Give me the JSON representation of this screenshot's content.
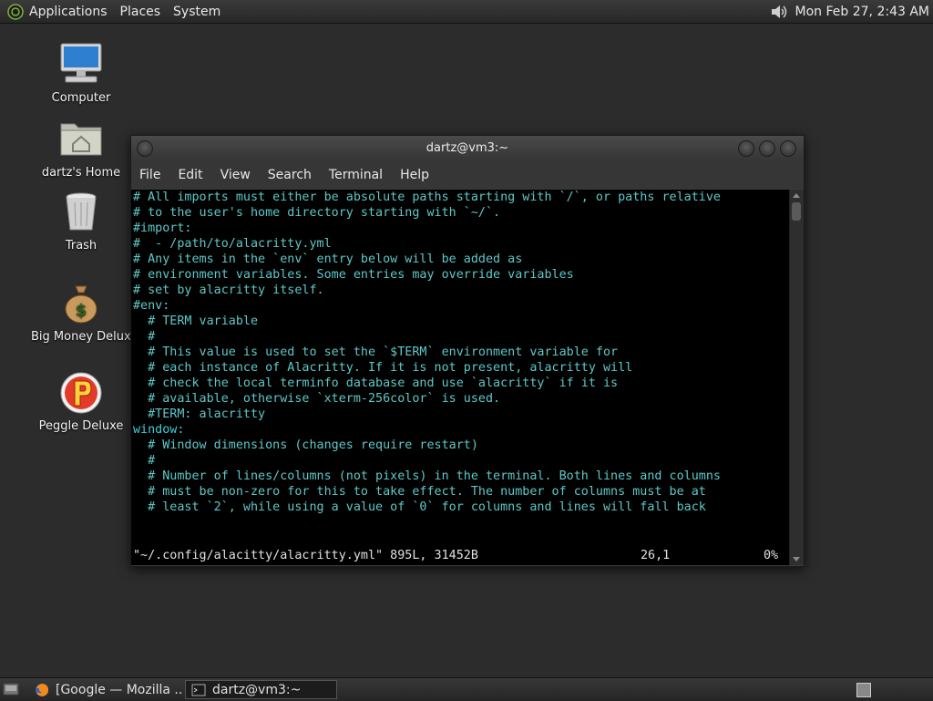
{
  "top_panel": {
    "menus": [
      "Applications",
      "Places",
      "System"
    ],
    "clock": "Mon Feb 27,  2:43 AM",
    "icons": [
      "distro-logo-icon",
      "volume-icon"
    ]
  },
  "desktop": {
    "icons": [
      {
        "label": "Computer",
        "icon": "computer-icon"
      },
      {
        "label": "dartz's Home",
        "icon": "home-folder-icon"
      },
      {
        "label": "Trash",
        "icon": "trash-icon"
      },
      {
        "label": "Big Money Deluxe",
        "icon": "money-bag-icon"
      },
      {
        "label": "Peggle Deluxe",
        "icon": "peggle-icon"
      }
    ]
  },
  "terminal": {
    "title": "dartz@vm3:~",
    "menus": [
      "File",
      "Edit",
      "View",
      "Search",
      "Terminal",
      "Help"
    ],
    "lines": [
      "# All imports must either be absolute paths starting with `/`, or paths relative",
      "# to the user's home directory starting with `~/`.",
      "#import:",
      "#  - /path/to/alacritty.yml",
      "",
      "# Any items in the `env` entry below will be added as",
      "# environment variables. Some entries may override variables",
      "# set by alacritty itself.",
      "#env:",
      "  # TERM variable",
      "  #",
      "  # This value is used to set the `$TERM` environment variable for",
      "  # each instance of Alacritty. If it is not present, alacritty will",
      "  # check the local terminfo database and use `alacritty` if it is",
      "  # available, otherwise `xterm-256color` is used.",
      "  #TERM: alacritty",
      "",
      "window:",
      "  # Window dimensions (changes require restart)",
      "  #",
      "  # Number of lines/columns (not pixels) in the terminal. Both lines and columns",
      "  # must be non-zero for this to take effect. The number of columns must be at",
      "  # least `2`, while using a value of `0` for columns and lines will fall back"
    ],
    "status": {
      "file": "\"~/.config/alacitty/alacritty.yml\" 895L, 31452B",
      "position": "26,1",
      "percent": "0%"
    }
  },
  "taskbar": {
    "tasks": [
      {
        "label": "[Google — Mozilla ...",
        "icon": "firefox-icon",
        "active": false
      },
      {
        "label": "dartz@vm3:~",
        "icon": "terminal-icon",
        "active": true
      }
    ]
  },
  "colors": {
    "terminal_text": "#5ec8c8",
    "terminal_bg": "#000000",
    "desktop_bg": "#2c2c2c"
  }
}
